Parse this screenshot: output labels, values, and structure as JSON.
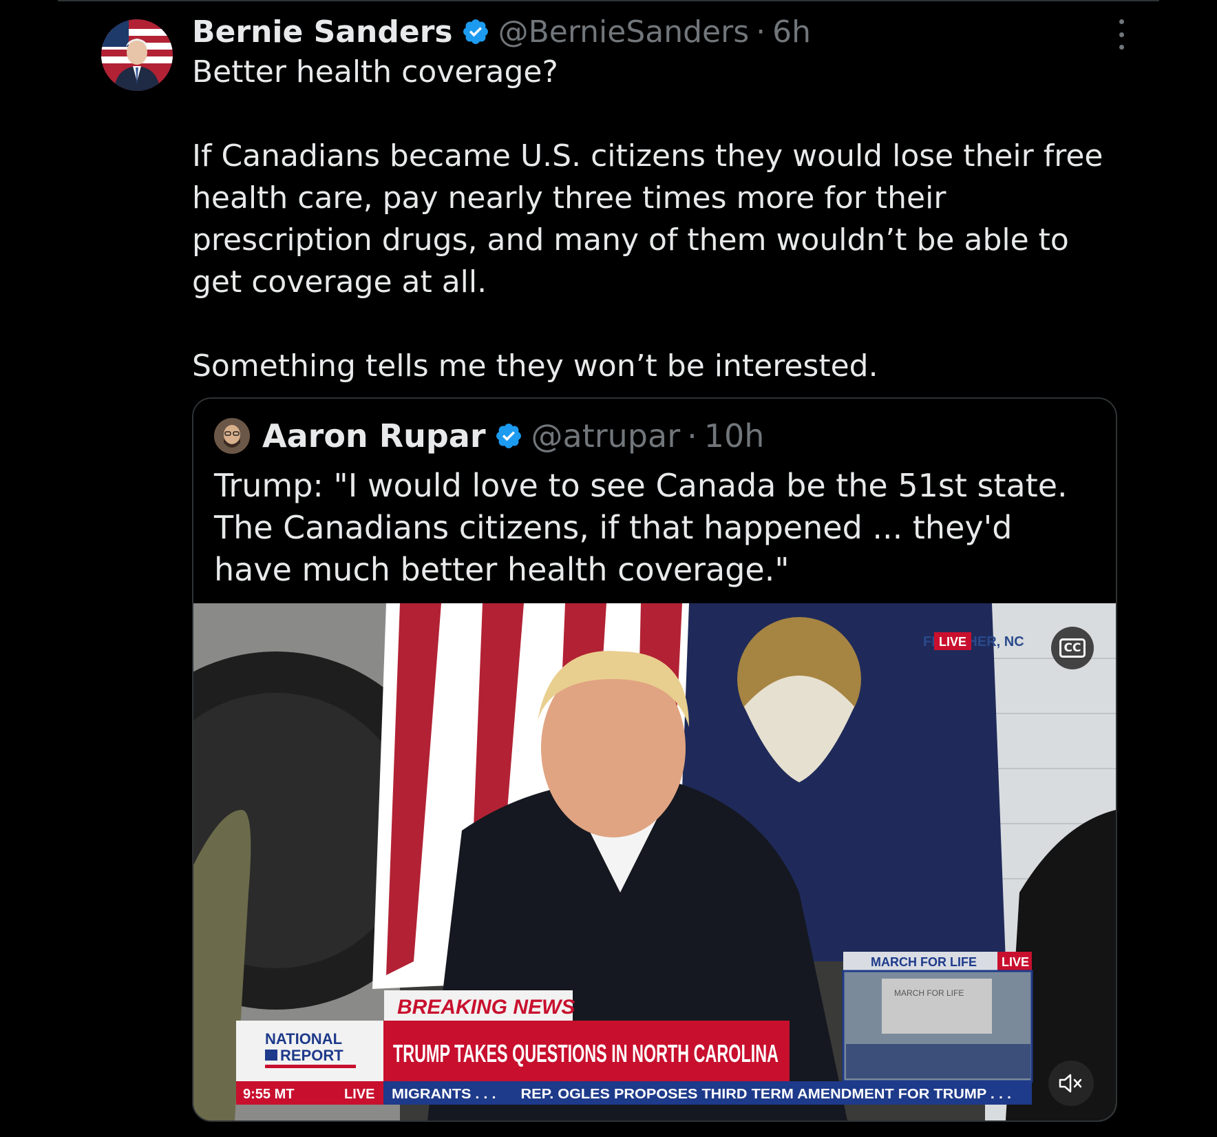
{
  "tweet": {
    "author_name": "Bernie Sanders",
    "handle": "@BernieSanders",
    "separator": "·",
    "time": "6h",
    "verified_icon": "verified-badge-icon",
    "more_icon": "more-options-icon",
    "text_line1": "Better health coverage?",
    "text_para2": "If Canadians became U.S. citizens they would lose their free health care, pay nearly three times more for their prescription drugs, and many of them wouldn’t be able to get coverage at all.",
    "text_para3": "Something tells me they won’t be interested."
  },
  "quoted_tweet": {
    "author_name": "Aaron Rupar",
    "handle": "@atrupar",
    "separator": "·",
    "time": "10h",
    "text": "Trump: \"I would love to see Canada be the 51st state. The Canadians citizens, if that happened ... they'd have much better health coverage.\""
  },
  "video": {
    "location": "FLETCHER, NC",
    "live_tag": "LIVE",
    "cc_label": "CC",
    "breaking_news": "BREAKING NEWS",
    "headline": "TRUMP TAKES QUESTIONS IN NORTH CAROLINA",
    "network_line1": "NATIONAL",
    "network_line2": "REPORT",
    "clock": "9:55 MT",
    "clock_live": "LIVE",
    "ticker": "MIGRANTS . . .      REP. OGLES PROPOSES THIRD TERM AMENDMENT FOR TRUMP . . .",
    "inset_title": "MARCH FOR LIFE",
    "inset_live": "LIVE",
    "inset_stage": "MARCH FOR LIFE",
    "mute_icon": "muted-speaker-icon",
    "colors": {
      "chyron_red": "#c8102e",
      "chyron_blue": "#1e3a8a",
      "verified_blue": "#1d9bf0"
    }
  }
}
